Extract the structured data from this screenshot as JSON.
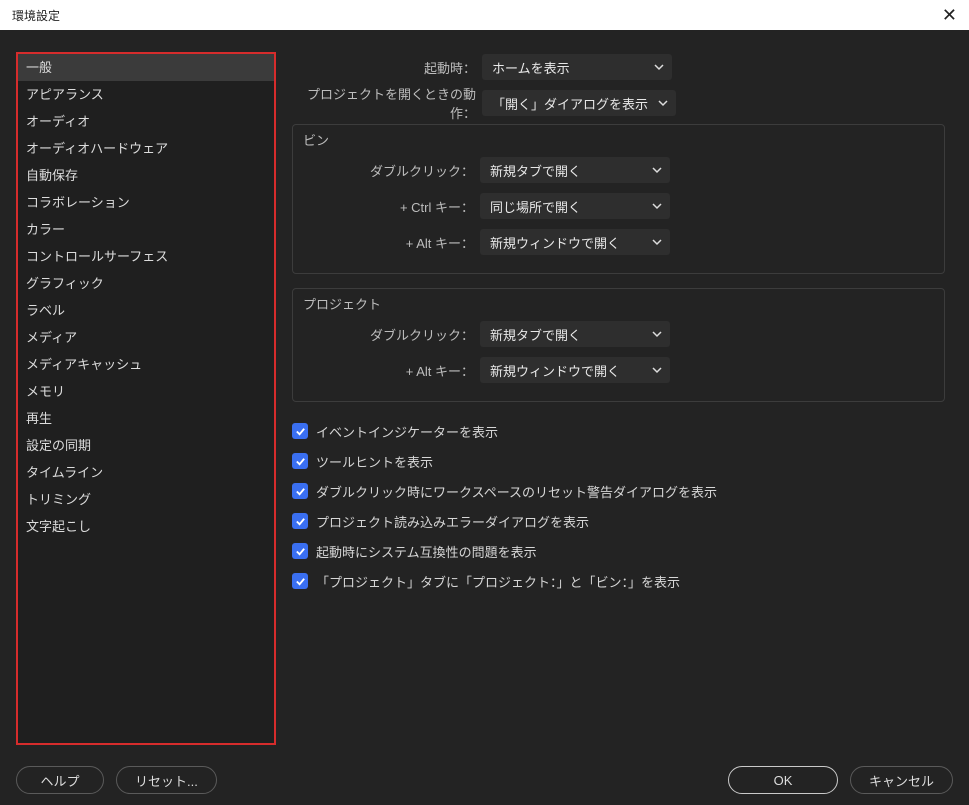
{
  "title": "環境設定",
  "sidebar": {
    "items": [
      "一般",
      "アピアランス",
      "オーディオ",
      "オーディオハードウェア",
      "自動保存",
      "コラボレーション",
      "カラー",
      "コントロールサーフェス",
      "グラフィック",
      "ラベル",
      "メディア",
      "メディアキャッシュ",
      "メモリ",
      "再生",
      "設定の同期",
      "タイムライン",
      "トリミング",
      "文字起こし"
    ],
    "selected": 0
  },
  "startup_label": "起動時：",
  "startup_value": "ホームを表示",
  "openproj_label": "プロジェクトを開くときの動作：",
  "openproj_value": "「開く」ダイアログを表示",
  "bin": {
    "legend": "ビン",
    "dblclick_label": "ダブルクリック：",
    "dblclick_value": "新規タブで開く",
    "ctrl_label": "+ Ctrl キー：",
    "ctrl_value": "同じ場所で開く",
    "alt_label": "+ Alt キー：",
    "alt_value": "新規ウィンドウで開く"
  },
  "project": {
    "legend": "プロジェクト",
    "dblclick_label": "ダブルクリック：",
    "dblclick_value": "新規タブで開く",
    "alt_label": "+ Alt キー：",
    "alt_value": "新規ウィンドウで開く"
  },
  "checks": [
    "イベントインジケーターを表示",
    "ツールヒントを表示",
    "ダブルクリック時にワークスペースのリセット警告ダイアログを表示",
    "プロジェクト読み込みエラーダイアログを表示",
    "起動時にシステム互換性の問題を表示",
    "「プロジェクト」タブに「プロジェクト：」と「ビン：」を表示"
  ],
  "buttons": {
    "help": "ヘルプ",
    "reset": "リセット...",
    "ok": "OK",
    "cancel": "キャンセル"
  }
}
